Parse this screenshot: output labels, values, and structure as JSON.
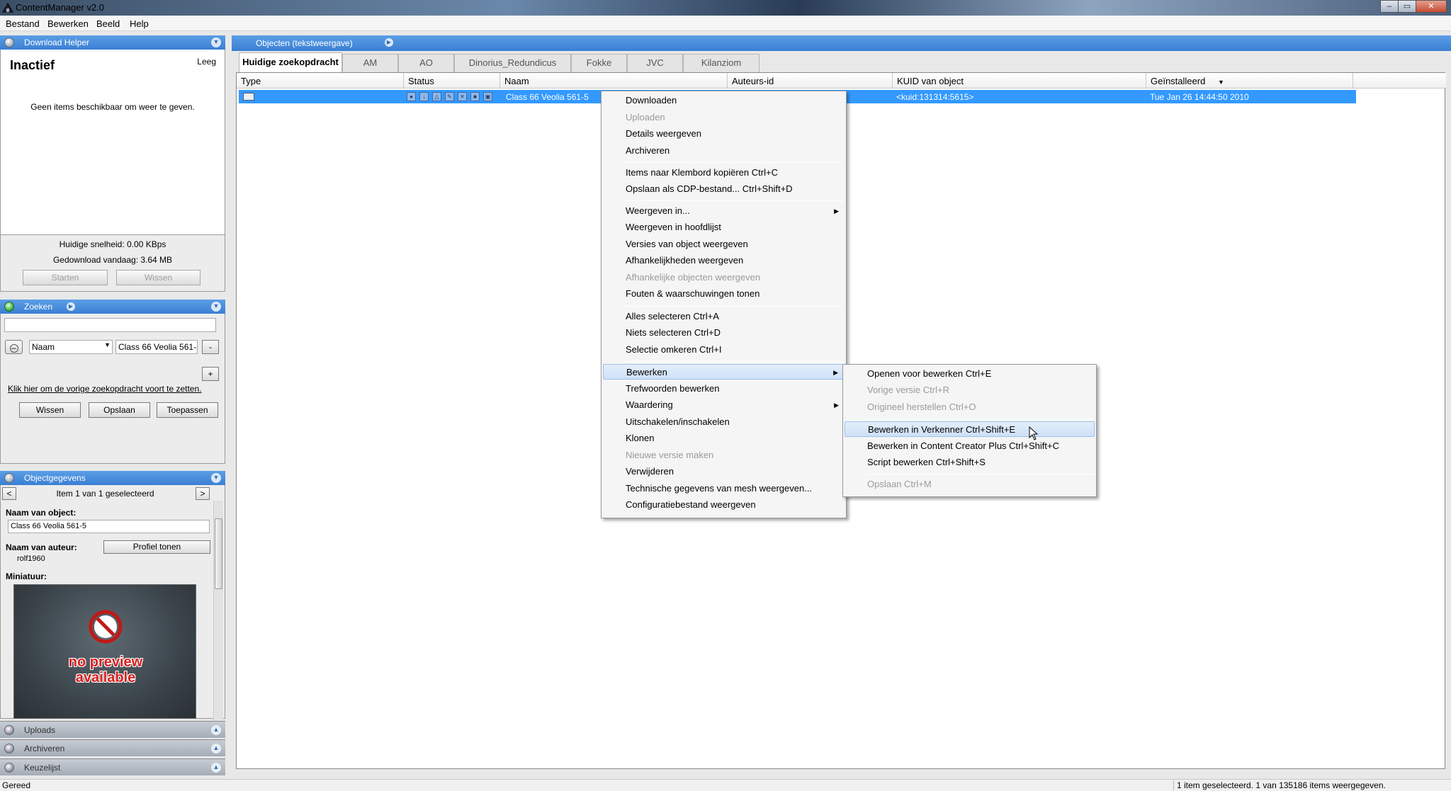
{
  "window": {
    "title": "ContentManager v2.0",
    "controls": [
      "–",
      "▭",
      "✕"
    ]
  },
  "menubar": [
    "Bestand",
    "Bewerken",
    "Beeld",
    "Help"
  ],
  "download_helper": {
    "title": "Download Helper",
    "status": "Inactief",
    "empty_link": "Leeg",
    "message": "Geen items beschikbaar om weer te geven.",
    "speed": "Huidige snelheid: 0.00 KBps",
    "downloaded": "Gedownload vandaag: 3.64 MB",
    "start": "Starten",
    "clear": "Wissen"
  },
  "search": {
    "title": "Zoeken",
    "query": "",
    "field": "Naam",
    "value": "Class 66 Veolia 561-5",
    "minus": "-",
    "plus": "+",
    "continue_link": "Klik hier om de vorige zoekopdracht voort te zetten.",
    "clear": "Wissen",
    "save": "Opslaan",
    "apply": "Toepassen"
  },
  "object_details": {
    "title": "Objectgegevens",
    "nav_prev": "<",
    "nav_next": ">",
    "nav_text": "Item 1 van 1 geselecteerd",
    "name_label": "Naam van object:",
    "name_value": "Class 66 Veolia 561-5",
    "author_label": "Naam van auteur:",
    "author_value": "rolf1960",
    "profile_button": "Profiel tonen",
    "thumb_label": "Miniatuur:",
    "preview_line1": "no preview",
    "preview_line2": "available"
  },
  "collapsed_panels": [
    "Uploads",
    "Archiveren",
    "Keuzelijst"
  ],
  "main": {
    "header_title": "Objecten (tekstweergave)",
    "tabs": [
      "Huidige zoekopdracht",
      "AM",
      "AO",
      "Dinorius_Redundicus",
      "Fokke",
      "JVC",
      "Kilanziom"
    ],
    "columns": [
      "Type",
      "Status",
      "Naam",
      "Auteurs-id",
      "KUID van object",
      "Geïnstalleerd"
    ],
    "row": {
      "name": "Class 66 Veolia 561-5",
      "kuid": "<kuid:131314:5615>",
      "installed": "Tue Jan 26 14:44:50 2010"
    }
  },
  "context_menu": [
    {
      "label": "Downloaden",
      "disabled": false
    },
    {
      "label": "Uploaden",
      "disabled": true
    },
    {
      "label": "Details weergeven",
      "disabled": false
    },
    {
      "label": "Archiveren",
      "disabled": false
    },
    {
      "label": "Items naar Klembord kopiëren Ctrl+C",
      "disabled": false
    },
    {
      "label": "Opslaan als CDP-bestand... Ctrl+Shift+D",
      "disabled": false
    },
    {
      "label": "Weergeven in...",
      "disabled": false,
      "submenu": true
    },
    {
      "label": "Weergeven in hoofdlijst",
      "disabled": false
    },
    {
      "label": "Versies van object weergeven",
      "disabled": false
    },
    {
      "label": "Afhankelijkheden weergeven",
      "disabled": false
    },
    {
      "label": "Afhankelijke objecten weergeven",
      "disabled": true
    },
    {
      "label": "Fouten & waarschuwingen tonen",
      "disabled": false
    },
    {
      "label": "Alles selecteren Ctrl+A",
      "disabled": false
    },
    {
      "label": "Niets selecteren Ctrl+D",
      "disabled": false
    },
    {
      "label": "Selectie omkeren Ctrl+I",
      "disabled": false
    },
    {
      "label": "Bewerken",
      "disabled": false,
      "submenu": true,
      "highlighted": true
    },
    {
      "label": "Trefwoorden bewerken",
      "disabled": false
    },
    {
      "label": "Waardering",
      "disabled": false,
      "submenu": true
    },
    {
      "label": "Uitschakelen/inschakelen",
      "disabled": false
    },
    {
      "label": "Klonen",
      "disabled": false
    },
    {
      "label": "Nieuwe versie maken",
      "disabled": true
    },
    {
      "label": "Verwijderen",
      "disabled": false
    },
    {
      "label": "Technische gegevens van mesh weergeven...",
      "disabled": false
    },
    {
      "label": "Configuratiebestand weergeven",
      "disabled": false
    }
  ],
  "submenu": [
    {
      "label": "Openen voor bewerken Ctrl+E",
      "disabled": false
    },
    {
      "label": "Vorige versie Ctrl+R",
      "disabled": true
    },
    {
      "label": "Origineel herstellen Ctrl+O",
      "disabled": true
    },
    {
      "label": "Bewerken in Verkenner Ctrl+Shift+E",
      "disabled": false,
      "highlighted": true
    },
    {
      "label": "Bewerken in Content Creator Plus Ctrl+Shift+C",
      "disabled": false
    },
    {
      "label": "Script bewerken Ctrl+Shift+S",
      "disabled": false
    },
    {
      "label": "Opslaan Ctrl+M",
      "disabled": true
    }
  ],
  "statusbar": {
    "left": "Gereed",
    "right": "1 item geselecteerd. 1 van 135186 items weergegeven."
  },
  "colors": {
    "header_blue": "#3a7fd4",
    "selection": "#3399ff",
    "disabled_text": "#9a9a9a"
  }
}
